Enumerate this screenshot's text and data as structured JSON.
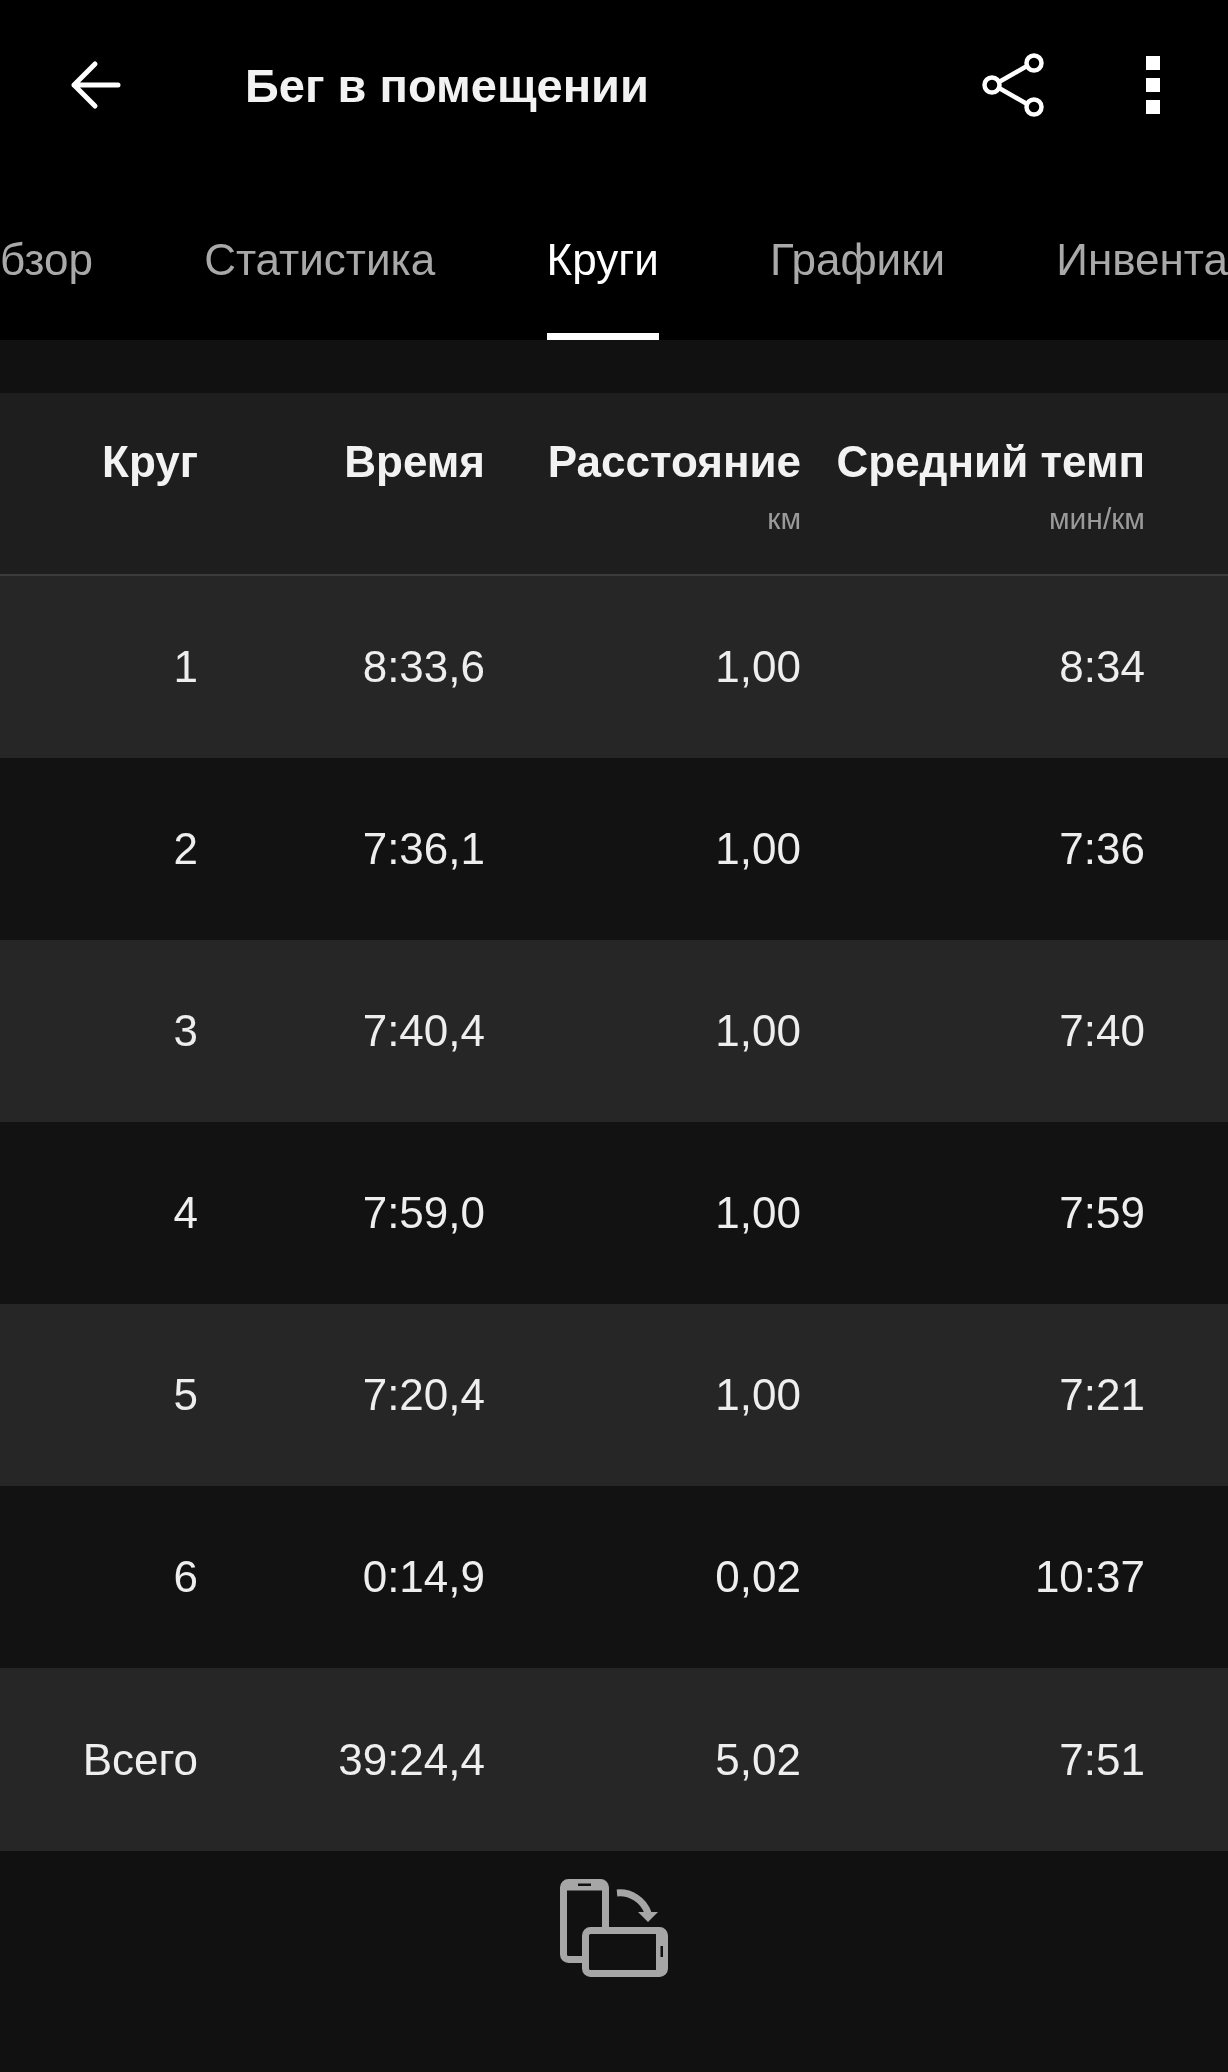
{
  "app_bar": {
    "title": "Бег в помещении"
  },
  "tabs": [
    {
      "label": "бзор",
      "selected": false
    },
    {
      "label": "Статистика",
      "selected": false
    },
    {
      "label": "Круги",
      "selected": true
    },
    {
      "label": "Графики",
      "selected": false
    },
    {
      "label": "Инвента",
      "selected": false
    }
  ],
  "table": {
    "columns": [
      {
        "label": "Круг"
      },
      {
        "label": "Время"
      },
      {
        "label": "Расстояние",
        "unit": "км"
      },
      {
        "label": "Средний темп",
        "unit": "мин/км"
      }
    ],
    "rows": [
      [
        "1",
        "8:33,6",
        "1,00",
        "8:34"
      ],
      [
        "2",
        "7:36,1",
        "1,00",
        "7:36"
      ],
      [
        "3",
        "7:40,4",
        "1,00",
        "7:40"
      ],
      [
        "4",
        "7:59,0",
        "1,00",
        "7:59"
      ],
      [
        "5",
        "7:20,4",
        "1,00",
        "7:21"
      ],
      [
        "6",
        "0:14,9",
        "0,02",
        "10:37"
      ]
    ],
    "total": [
      "Всего",
      "39:24,4",
      "5,02",
      "7:51"
    ]
  }
}
